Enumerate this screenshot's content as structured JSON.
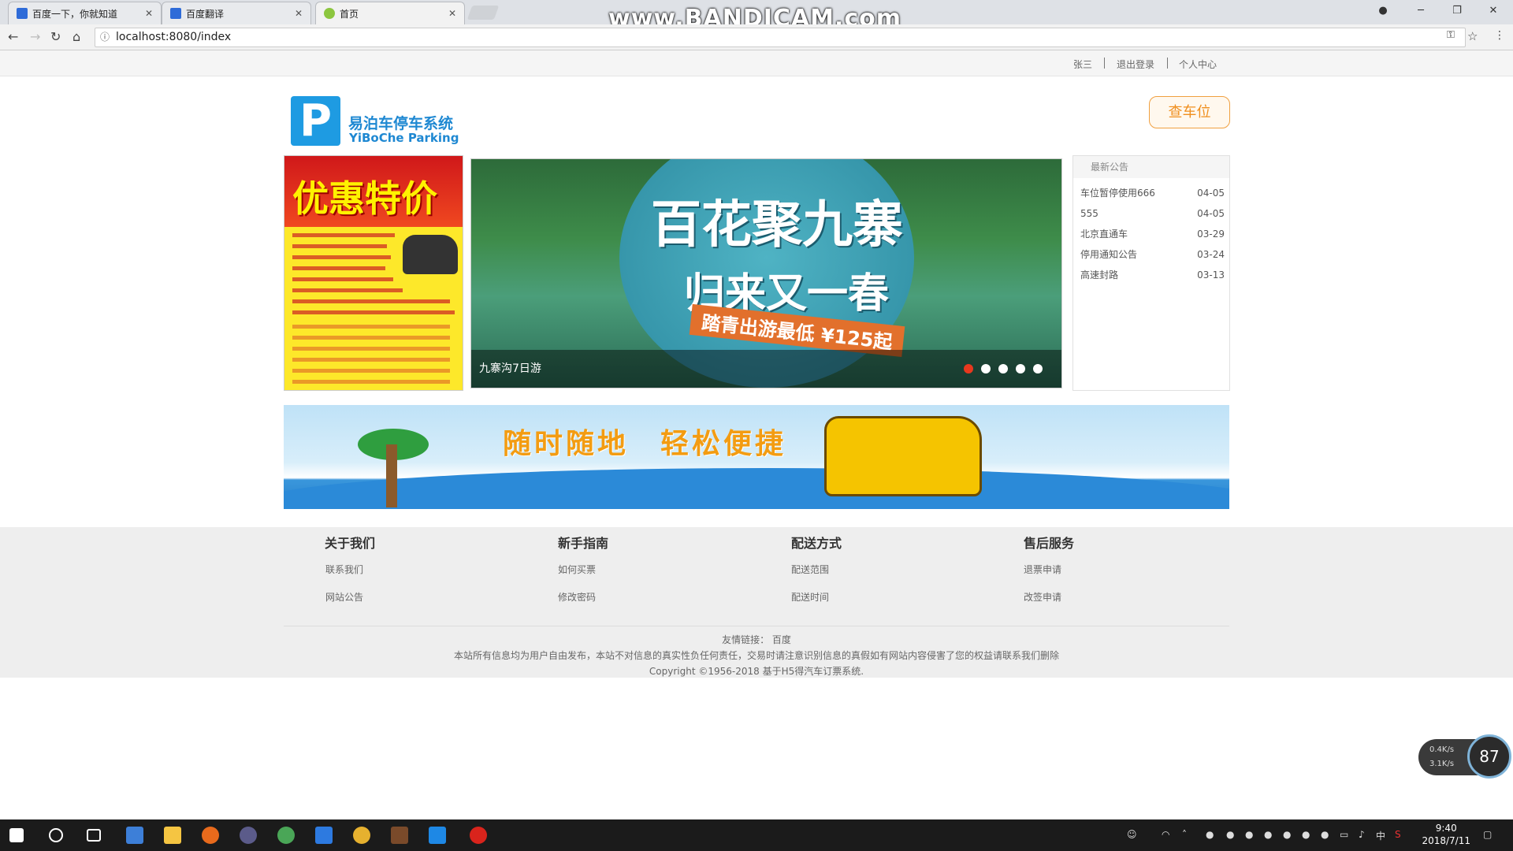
{
  "browser": {
    "tabs": [
      {
        "title": "百度一下，你就知道"
      },
      {
        "title": "百度翻译"
      },
      {
        "title": "首页"
      }
    ],
    "url": "localhost:8080/index",
    "watermark": "www.BANDICAM.com"
  },
  "topbar": {
    "user": "张三",
    "logout": "退出登录",
    "profile": "个人中心"
  },
  "logo": {
    "icon_letter": "P",
    "cn": "易泊车停车系统",
    "en": "YiBoChe  Parking"
  },
  "find_button": "查车位",
  "promo": {
    "title": "优惠特价"
  },
  "carousel": {
    "slide_title_1": "百花聚九寨",
    "slide_title_2": "归来又一春",
    "slide_tag": "踏青出游最低 ¥125起",
    "caption": "九寨沟7日游",
    "slides": 5,
    "active": 0
  },
  "notices": {
    "header": "最新公告",
    "items": [
      {
        "title": "车位暂停使用666",
        "date": "04-05"
      },
      {
        "title": "555",
        "date": "04-05"
      },
      {
        "title": "北京直通车",
        "date": "03-29"
      },
      {
        "title": "停用通知公告",
        "date": "03-24"
      },
      {
        "title": "高速封路",
        "date": "03-13"
      }
    ]
  },
  "banner": {
    "text": "随时随地　轻松便捷"
  },
  "footer": {
    "columns": [
      {
        "title": "关于我们",
        "links": [
          "联系我们",
          "网站公告"
        ]
      },
      {
        "title": "新手指南",
        "links": [
          "如何买票",
          "修改密码"
        ]
      },
      {
        "title": "配送方式",
        "links": [
          "配送范围",
          "配送时间"
        ]
      },
      {
        "title": "售后服务",
        "links": [
          "退票申请",
          "改签申请"
        ]
      }
    ],
    "friend_links_label": "友情链接：",
    "friend_link": "百度",
    "disclaimer": "本站所有信息均为用户自由发布，本站不对信息的真实性负任何责任，交易时请注意识别信息的真假如有网站内容侵害了您的权益请联系我们删除",
    "copyright": "Copyright ©1956-2018 基于H5得汽车订票系统."
  },
  "netmonitor": {
    "up": "0.4K/s",
    "down": "3.1K/s",
    "percent": "87"
  },
  "taskbar": {
    "time": "9:40",
    "date": "2018/7/11",
    "ime": "中"
  }
}
